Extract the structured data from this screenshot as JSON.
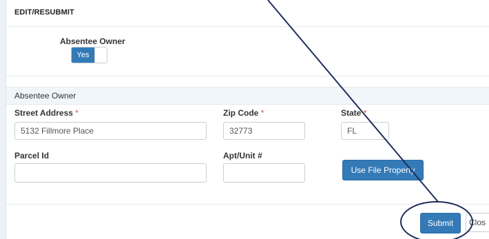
{
  "header": {
    "title": "EDIT/RESUBMIT"
  },
  "toggle": {
    "label": "Absentee Owner",
    "on_text": "Yes"
  },
  "section": {
    "title": "Absentee Owner"
  },
  "form": {
    "street": {
      "label": "Street Address",
      "required": "*",
      "value": "5132 Fillmore Place"
    },
    "zip": {
      "label": "Zip Code",
      "required": "*",
      "value": "32773"
    },
    "state": {
      "label": "State",
      "required": "*",
      "value": "FL"
    },
    "parcel": {
      "label": "Parcel Id",
      "value": ""
    },
    "apt": {
      "label": "Apt/Unit #",
      "value": ""
    },
    "use_file_property": "Use File Property"
  },
  "footer": {
    "submit": "Submit",
    "close": "Clos"
  },
  "colors": {
    "primary": "#337ab7",
    "annotation": "#1f2d5a",
    "required": "#d9534f"
  }
}
